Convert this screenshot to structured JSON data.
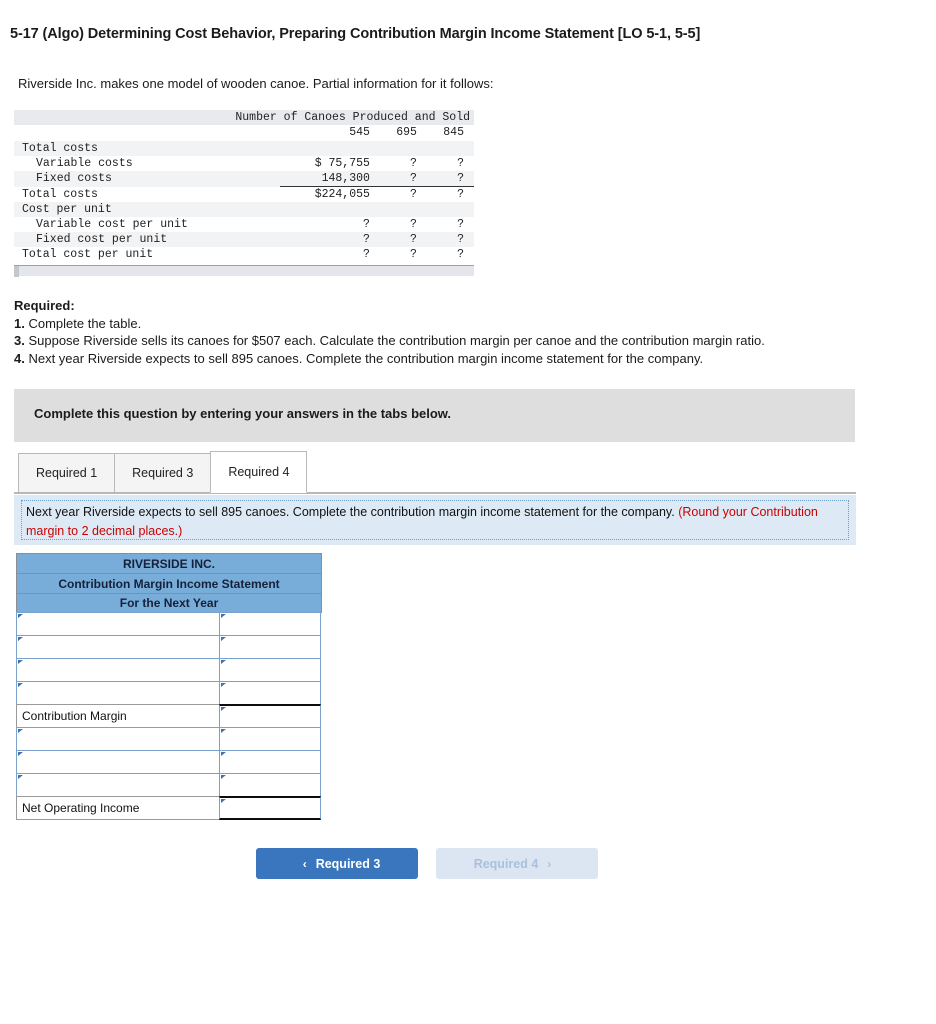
{
  "question": {
    "title": "5-17 (Algo) Determining Cost Behavior, Preparing Contribution Margin Income Statement [LO 5-1, 5-5]",
    "intro": "Riverside Inc. makes one model of wooden canoe. Partial information for it follows:"
  },
  "cost_table": {
    "group_header": "Number of Canoes Produced and Sold",
    "columns": [
      "545",
      "695",
      "845"
    ],
    "rows": [
      {
        "label": "Total costs",
        "indent": false,
        "shaded": true,
        "values": [
          "",
          "",
          ""
        ],
        "underline": false
      },
      {
        "label": "Variable costs",
        "indent": true,
        "shaded": false,
        "values": [
          "$ 75,755",
          "?",
          "?"
        ],
        "underline": false
      },
      {
        "label": "Fixed costs",
        "indent": true,
        "shaded": true,
        "values": [
          "148,300",
          "?",
          "?"
        ],
        "underline": true
      },
      {
        "label": "Total costs",
        "indent": false,
        "shaded": false,
        "values": [
          "$224,055",
          "?",
          "?"
        ],
        "underline": false
      },
      {
        "label": "Cost per unit",
        "indent": false,
        "shaded": true,
        "values": [
          "",
          "",
          ""
        ],
        "underline": false
      },
      {
        "label": "Variable cost per unit",
        "indent": true,
        "shaded": false,
        "values": [
          "?",
          "?",
          "?"
        ],
        "underline": false
      },
      {
        "label": "Fixed cost per unit",
        "indent": true,
        "shaded": true,
        "values": [
          "?",
          "?",
          "?"
        ],
        "underline": false
      },
      {
        "label": "Total cost per unit",
        "indent": false,
        "shaded": false,
        "values": [
          "?",
          "?",
          "?"
        ],
        "underline": false
      }
    ]
  },
  "required": {
    "heading": "Required:",
    "items": [
      {
        "num": "1.",
        "text": "Complete the table."
      },
      {
        "num": "3.",
        "text": "Suppose Riverside sells its canoes for $507 each. Calculate the contribution margin per canoe and the contribution margin ratio."
      },
      {
        "num": "4.",
        "text": "Next year Riverside expects to sell 895 canoes. Complete the contribution margin income statement for the company."
      }
    ]
  },
  "grey_banner": {
    "text": "Complete this question by entering your answers in the tabs below."
  },
  "tabs": {
    "items": [
      {
        "label": "Required 1",
        "active": false
      },
      {
        "label": "Required 3",
        "active": false
      },
      {
        "label": "Required 4",
        "active": true
      }
    ]
  },
  "prompt": {
    "text": "Next year Riverside expects to sell 895 canoes. Complete the contribution margin income statement for the company.",
    "note": "(Round your Contribution margin to 2 decimal places.)",
    "note_color": "#cc0000"
  },
  "statement": {
    "header_lines": [
      "RIVERSIDE INC.",
      "Contribution Margin Income Statement",
      "For the Next Year"
    ],
    "header_bg": "#79add9",
    "rows": [
      {
        "label": "",
        "value": "",
        "label_editable": true,
        "value_editable": true,
        "value_top_rule": false,
        "value_bottom_rule": false
      },
      {
        "label": "",
        "value": "",
        "label_editable": true,
        "value_editable": true,
        "value_top_rule": false,
        "value_bottom_rule": false
      },
      {
        "label": "",
        "value": "",
        "label_editable": true,
        "value_editable": true,
        "value_top_rule": false,
        "value_bottom_rule": false
      },
      {
        "label": "",
        "value": "",
        "label_editable": true,
        "value_editable": true,
        "value_top_rule": false,
        "value_bottom_rule": false
      },
      {
        "label": "Contribution Margin",
        "value": "",
        "label_editable": false,
        "value_editable": true,
        "value_top_rule": true,
        "value_bottom_rule": false
      },
      {
        "label": "",
        "value": "",
        "label_editable": true,
        "value_editable": true,
        "value_top_rule": false,
        "value_bottom_rule": false
      },
      {
        "label": "",
        "value": "",
        "label_editable": true,
        "value_editable": true,
        "value_top_rule": false,
        "value_bottom_rule": false
      },
      {
        "label": "",
        "value": "",
        "label_editable": true,
        "value_editable": true,
        "value_top_rule": false,
        "value_bottom_rule": false
      },
      {
        "label": "Net Operating Income",
        "value": "",
        "label_editable": false,
        "value_editable": true,
        "value_top_rule": true,
        "value_bottom_rule": true
      }
    ]
  },
  "nav": {
    "prev_label": "Required 3",
    "prev_icon": "chevron-left",
    "prev_glyph": "‹",
    "next_label": "Required 4",
    "next_icon": "chevron-right",
    "next_glyph": "›",
    "prev_color": "#3a76bd",
    "next_color": "#dbe6f2"
  }
}
